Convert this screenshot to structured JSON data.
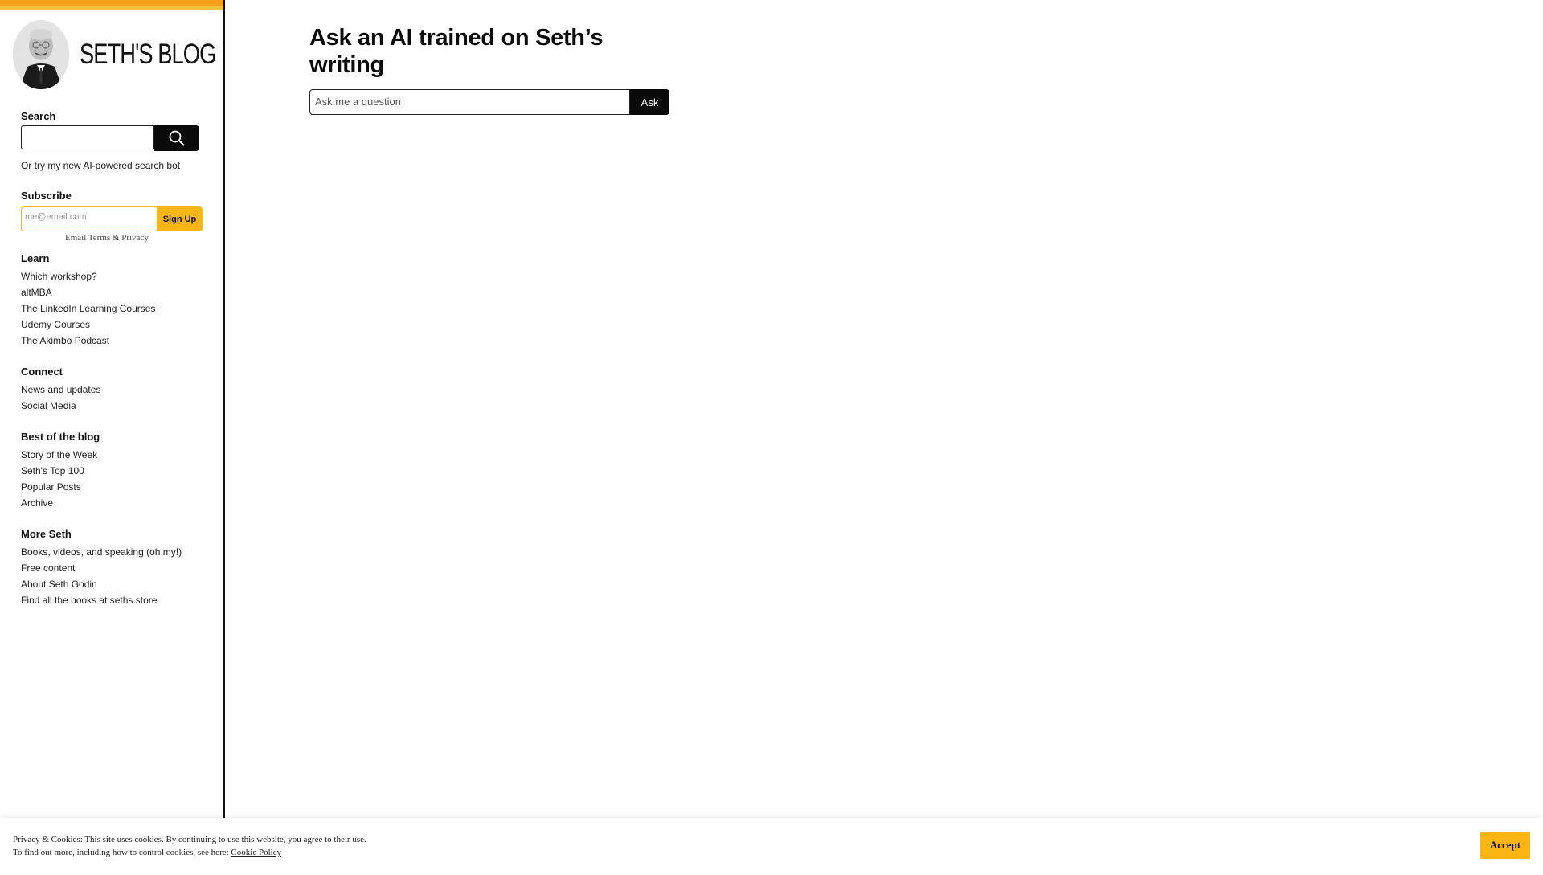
{
  "sidebar": {
    "title": "SETH'S BLOG",
    "search_label": "Search",
    "ai_bot_link": "Or try my new AI-powered search bot",
    "subscribe_label": "Subscribe",
    "email_placeholder": "me@email.com",
    "signup_label": "Sign Up",
    "email_terms": "Email Terms & Privacy",
    "groups": [
      {
        "label": "Learn",
        "items": [
          "Which workshop?",
          "altMBA",
          "The LinkedIn Learning Courses",
          "Udemy Courses",
          "The Akimbo Podcast"
        ]
      },
      {
        "label": "Connect",
        "items": [
          "News and updates",
          "Social Media"
        ]
      },
      {
        "label": "Best of the blog",
        "items": [
          "Story of the Week",
          "Seth's Top 100",
          "Popular Posts",
          "Archive"
        ]
      },
      {
        "label": "More Seth",
        "items": [
          "Books, videos, and speaking (oh my!)",
          "Free content",
          "About Seth Godin",
          "Find all the books at seths.store"
        ]
      }
    ]
  },
  "main": {
    "heading": "Ask an AI trained on Seth’s writing",
    "ask_placeholder": "Ask me a question",
    "ask_button": "Ask"
  },
  "cookie": {
    "line1": "Privacy & Cookies: This site uses cookies. By continuing to use this website, you agree to their use.",
    "line2": "To find out more, including how to control cookies, see here: ",
    "policy_link": "Cookie Policy",
    "accept": "Accept"
  },
  "colors": {
    "accent": "#fbb515",
    "top_bar": "#f7a11a"
  }
}
